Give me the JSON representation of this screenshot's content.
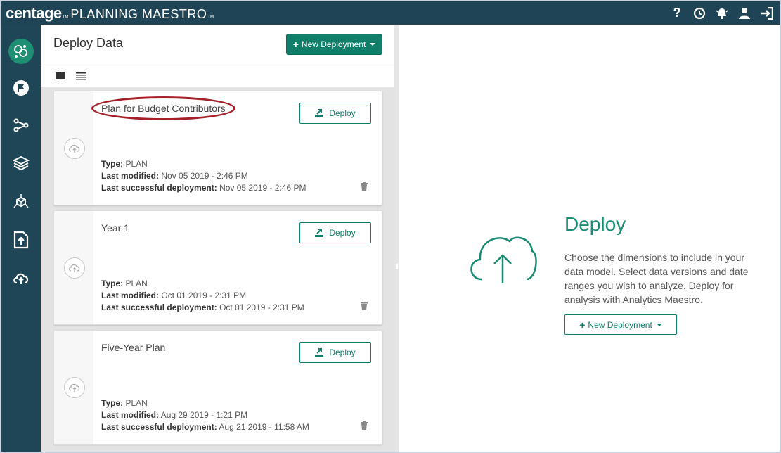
{
  "app": {
    "logo": "centage",
    "logo_tm": "TM",
    "product": "PLANNING MAESTRO",
    "product_tm": "TM"
  },
  "topbar": {
    "icons": [
      "help-icon",
      "history-icon",
      "alerts-icon",
      "user-icon",
      "logout-icon"
    ],
    "help_label": "?"
  },
  "sidebar": {
    "items": [
      {
        "name": "app-home",
        "icon": "circles-logo-icon"
      },
      {
        "name": "flag",
        "icon": "flag-icon"
      },
      {
        "name": "workflow",
        "icon": "nodes-icon"
      },
      {
        "name": "layers",
        "icon": "layers-icon"
      },
      {
        "name": "model",
        "icon": "cube-network-icon"
      },
      {
        "name": "upload-file",
        "icon": "file-upload-icon"
      },
      {
        "name": "deploy",
        "icon": "cloud-upload-icon"
      }
    ]
  },
  "list": {
    "title": "Deploy Data",
    "new_button": "New Deployment",
    "view_grid": "grid-view-icon",
    "view_list": "list-view-icon",
    "deploy_label": "Deploy",
    "type_label": "Type:",
    "modified_label": "Last modified:",
    "success_label": "Last successful deployment:",
    "cards": [
      {
        "title": "Plan for Budget Contributors",
        "type": "PLAN",
        "modified": "Nov 05 2019 - 2:46 PM",
        "success": "Nov 05 2019 - 2:46 PM"
      },
      {
        "title": "Year 1",
        "type": "PLAN",
        "modified": "Oct 01 2019 - 2:31 PM",
        "success": "Oct 01 2019 - 2:31 PM"
      },
      {
        "title": "Five-Year Plan",
        "type": "PLAN",
        "modified": "Aug 29 2019 - 1:21 PM",
        "success": "Aug 21 2019 - 11:58 AM"
      }
    ]
  },
  "detail": {
    "heading": "Deploy",
    "description": "Choose the dimensions to include in your data model. Select data versions and date ranges you wish to analyze. Deploy for analysis with Analytics Maestro.",
    "new_button": "New Deployment"
  },
  "colors": {
    "topbar": "#1f4456",
    "accent": "#107e69",
    "highlight_circle": "#a6202a"
  }
}
